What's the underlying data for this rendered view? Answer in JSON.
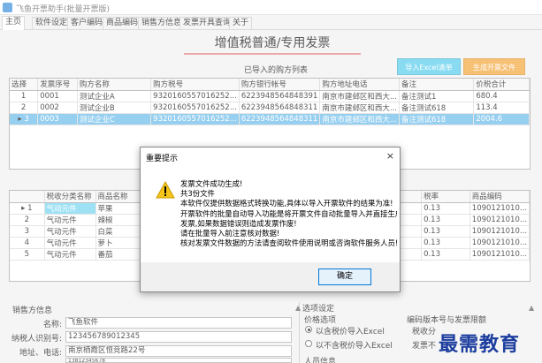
{
  "window": {
    "title": "飞鱼开票助手(批量开票版)"
  },
  "menu": [
    "主页",
    "软件设定",
    "客户编码",
    "商品编码",
    "销售方信息",
    "发票开具查询",
    "关于"
  ],
  "banner": {
    "title": "增值税普通/专用发票"
  },
  "buttons": {
    "import_excel": "导入Excel清单",
    "generate_invoice": "生成开票文件"
  },
  "buyer_list": {
    "title": "已导入的购方列表",
    "columns": [
      "选择",
      "发票序号",
      "购方名称",
      "购方税号",
      "购方银行帐号",
      "购方地址电话",
      "备注",
      "价税合计"
    ],
    "rows": [
      [
        "1",
        "0001",
        "测试企业A",
        "9320160557016252...",
        "6223948564848391",
        "南京市建邺区和西大...",
        "备注测试1",
        "680.4"
      ],
      [
        "2",
        "0002",
        "测试企业B",
        "9320160557016252...",
        "6223948564848311",
        "南京市建邺区和西大...",
        "备注测试618",
        "113.4"
      ],
      [
        "3",
        "0003",
        "测试企业C",
        "9320160557016252...",
        "6223948564848311",
        "南京市建邺区和西大...",
        "备注测试618",
        "2004.6"
      ]
    ]
  },
  "goods_list": {
    "columns": [
      "税收分类名称",
      "商品名称",
      "税率",
      "商品编码"
    ],
    "rows": [
      [
        "1",
        "气动元件",
        "苹果",
        "0.13",
        "1090121010..."
      ],
      [
        "2",
        "气动元件",
        "辣椒",
        "0.13",
        "1090121010..."
      ],
      [
        "3",
        "气动元件",
        "白菜",
        "0.13",
        "1090121010..."
      ],
      [
        "4",
        "气动元件",
        "萝卜",
        "0.13",
        "1090121010..."
      ],
      [
        "5",
        "气动元件",
        "番茄",
        "0.13",
        "1090121010..."
      ]
    ]
  },
  "seller": {
    "group_label": "销售方信息",
    "name_label": "名称:",
    "name_value": "飞鱼软件",
    "taxid_label": "纳税人识别号:",
    "taxid_value": "123456789012345",
    "address_label": "地址、电话:",
    "address_value": "南京栖霞区恒竞路22号",
    "extra_value": "13812345678"
  },
  "options": {
    "group_label": "选项设定",
    "price_label": "价格选项",
    "tax_included": "以含税价导入Excel",
    "tax_excluded": "以不含税价导入Excel",
    "version_label": "编码版本号与发票限额",
    "tax_class_label": "税收分",
    "invoice_limit_label": "发票不",
    "personnel_label": "人员信息"
  },
  "dialog": {
    "title": "重要提示",
    "close": "×",
    "lines": [
      "发票文件成功生成!",
      "共3份文件",
      "本软件仅提供数据格式转换功能,具体以导入开票软件的结果为准!",
      "开票软件的批量自动导入功能是将开票文件自动批量导入并直接生成",
      "发票,如果数据错误则造成发票作废!",
      "请在批量导入前注意核对数据!",
      "核对发票文件数据的方法请查阅软件使用说明或咨询软件服务人员!"
    ],
    "ok_label": "确定"
  },
  "watermark": "最需教育"
}
